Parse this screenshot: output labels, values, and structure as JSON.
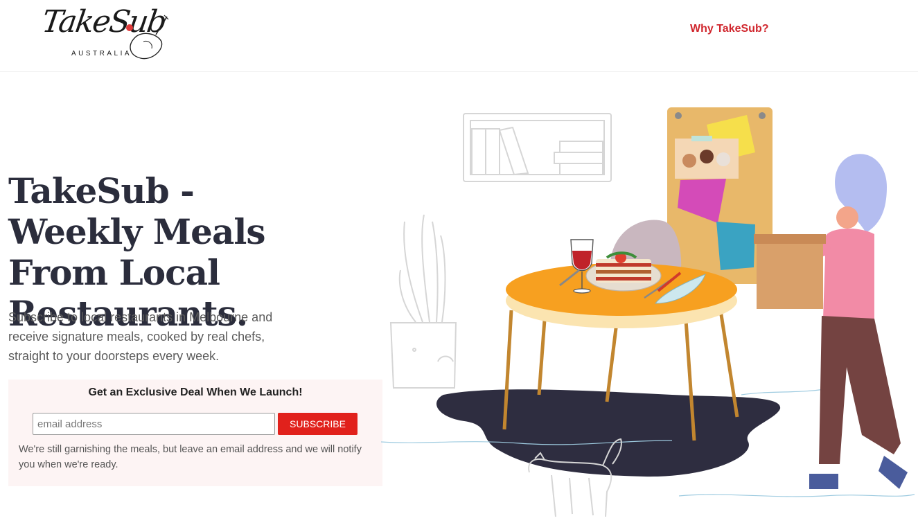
{
  "header": {
    "logo": {
      "script_text": "TakeSub",
      "subtitle": "AUSTRALIA"
    },
    "nav": {
      "why_link": "Why TakeSub?"
    }
  },
  "hero": {
    "title": "TakeSub - Weekly Meals From Local Restaurants.",
    "subtitle": "Subscribe to local restaurants in Melbourne and receive signature meals, cooked by real chefs, straight to your doorsteps every week."
  },
  "signup": {
    "title": "Get an Exclusive Deal When We Launch!",
    "email_value": "",
    "email_placeholder": "email address",
    "button_label": "SUBSCRIBE",
    "note": "We're still garnishing the meals, but leave an email address and we will notify you when we're ready."
  },
  "colors": {
    "accent_red": "#e1211c",
    "nav_red": "#d0262d",
    "title_navy": "#2b2d3c",
    "signup_bg": "#fdf4f4"
  },
  "illustration": {
    "icons": [
      "bookshelf-icon",
      "plant-icon",
      "corkboard-icon",
      "table-icon",
      "wine-glass-icon",
      "lasagna-icon",
      "chair-icon",
      "woman-with-box-icon",
      "cat-icon",
      "rug-icon"
    ]
  }
}
